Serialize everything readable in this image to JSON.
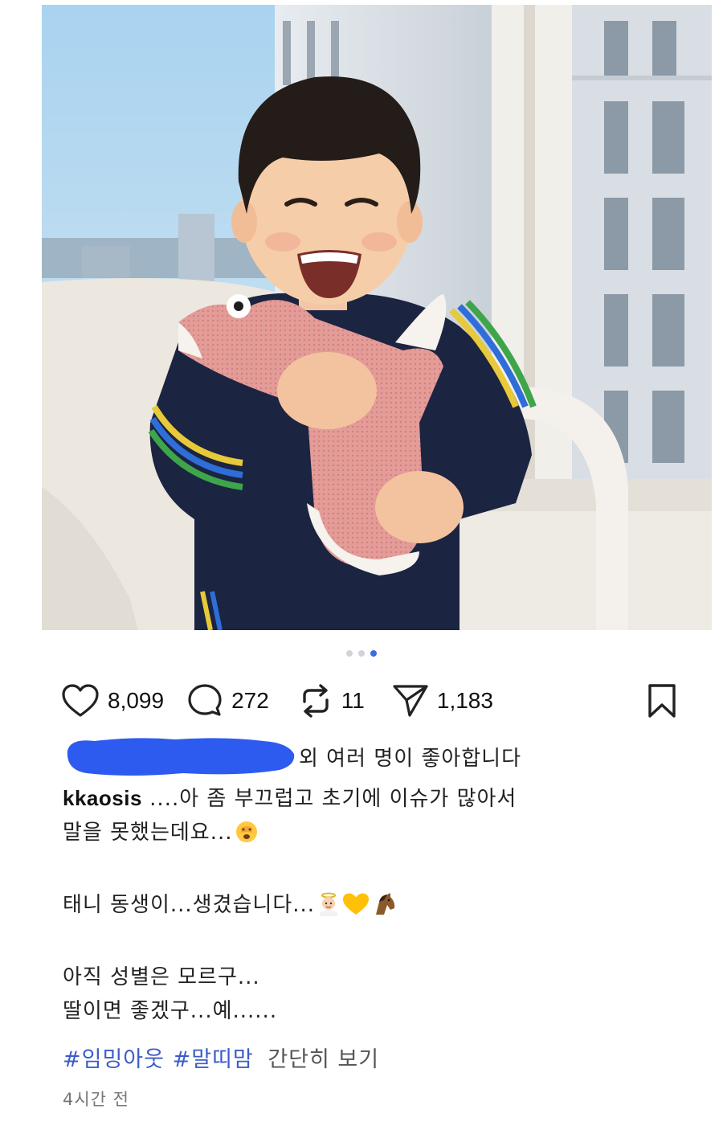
{
  "post": {
    "carousel": {
      "total": 3,
      "active_index": 3
    },
    "actions": {
      "like_icon": "heart-icon",
      "like_count": "8,099",
      "comment_icon": "comment-icon",
      "comment_count": "272",
      "repost_icon": "repost-icon",
      "repost_count": "11",
      "share_icon": "send-icon",
      "share_count": "1,183",
      "save_icon": "bookmark-icon"
    },
    "liked_by_suffix": "외 여러 명이 좋아합니다",
    "username": "kkaosis",
    "caption_line1": "....아 좀 부끄럽고 초기에 이슈가 많아서",
    "caption_line2": "말을 못했는데요...",
    "caption_line3": "태니 동생이...생겼습니다...",
    "caption_line4": "아직 성별은 모르구...",
    "caption_line5": "딸이면 좋겠구...예......",
    "emojis": {
      "line2": "face-with-hand-over-eyes-emoji",
      "line3": [
        "baby-angel-emoji",
        "yellow-heart-emoji",
        "horse-face-emoji"
      ]
    },
    "hashtags": [
      "#임밍아웃",
      "#말띠맘"
    ],
    "collapse_label": "간단히 보기",
    "timestamp": "4시간 전"
  },
  "colors": {
    "accent_blue": "#3f6ae0",
    "hashtag_blue": "#3d5cc8",
    "redaction_blue": "#2d5bf0",
    "text_primary": "#111111",
    "text_muted": "#777777"
  }
}
